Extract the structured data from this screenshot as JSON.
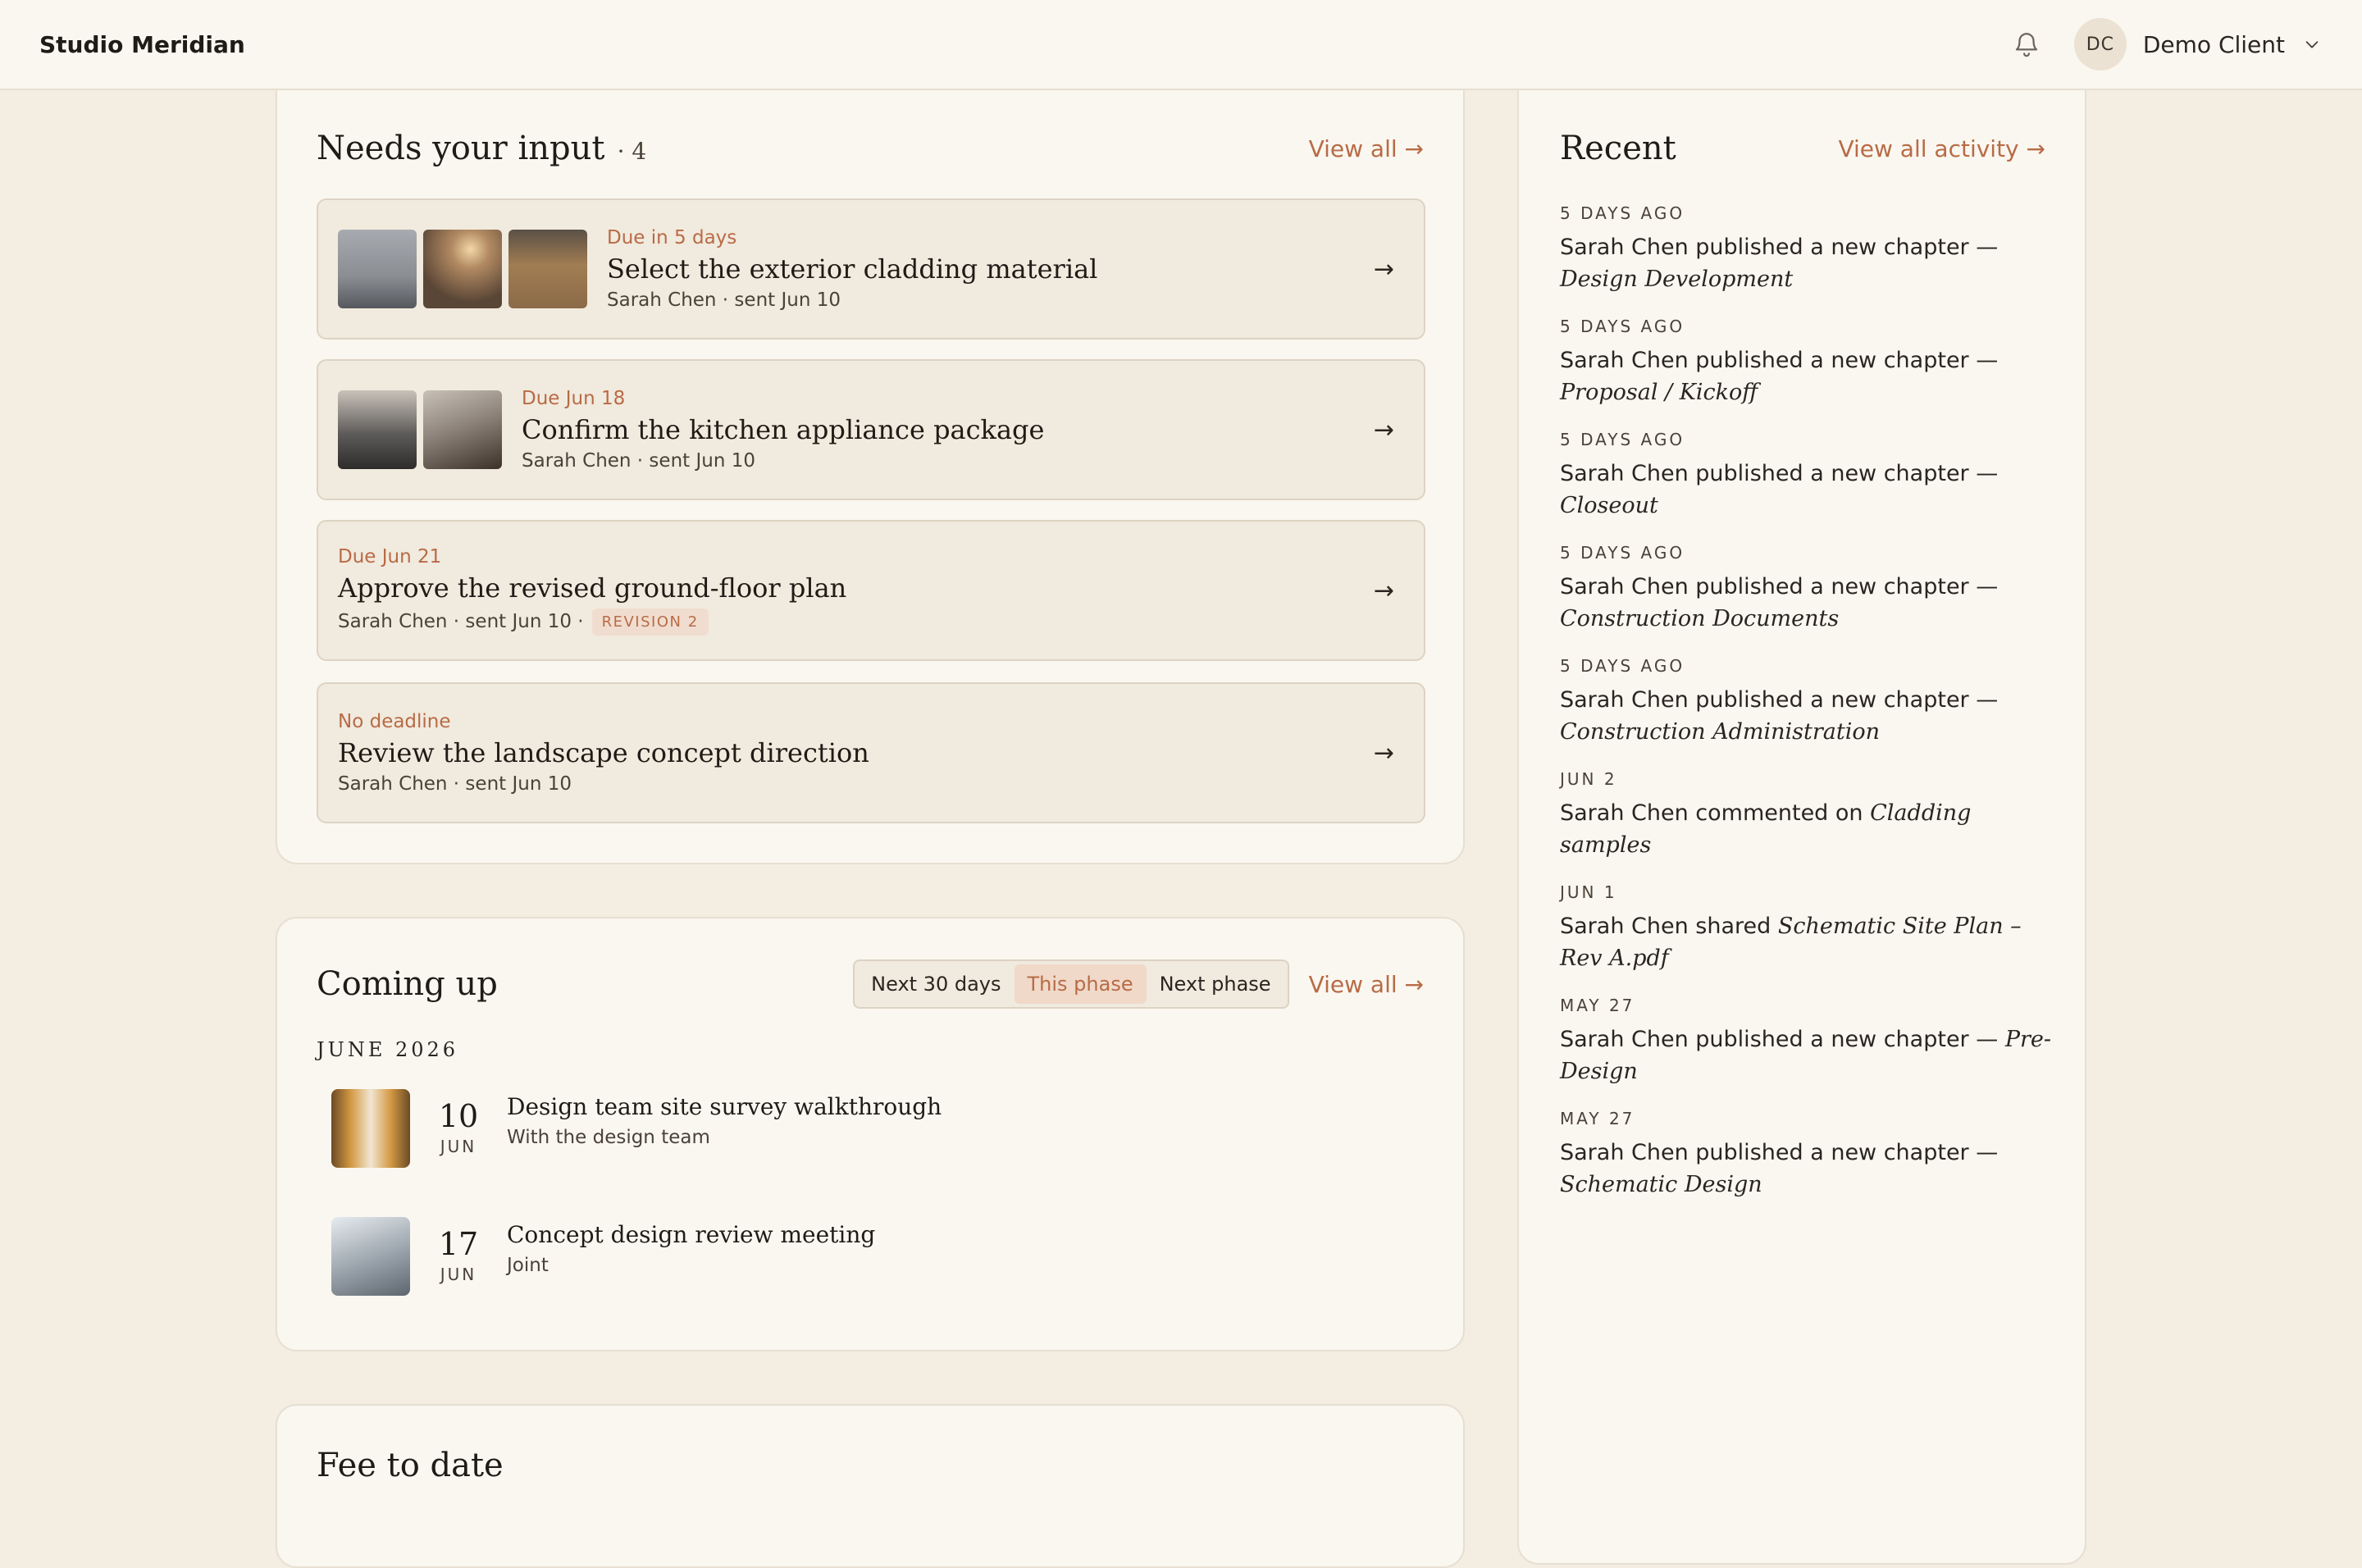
{
  "header": {
    "brand": "Studio Meridian",
    "user_initials": "DC",
    "user_name": "Demo Client"
  },
  "needs_input": {
    "title": "Needs your input",
    "count": "· 4",
    "view_all": "View all →",
    "items": [
      {
        "due": "Due in 5 days",
        "title": "Select the exterior cladding material",
        "meta": "Sarah Chen · sent Jun 10",
        "thumbs": [
          "#8a8d92",
          "#6f5a46",
          "#8b6a48"
        ]
      },
      {
        "due": "Due Jun 18",
        "title": "Confirm the kitchen appliance package",
        "meta": "Sarah Chen · sent Jun 10",
        "thumbs": [
          "#5e5c5a",
          "#8f857c"
        ]
      },
      {
        "due": "Due Jun 21",
        "title": "Approve the revised ground-floor plan",
        "meta": "Sarah Chen · sent Jun 10 ·",
        "badge": "REVISION 2"
      },
      {
        "due": "No deadline",
        "title": "Review the landscape concept direction",
        "meta": "Sarah Chen · sent Jun 10"
      }
    ],
    "arrow": "→"
  },
  "coming_up": {
    "title": "Coming up",
    "segments": [
      "Next 30 days",
      "This phase",
      "Next phase"
    ],
    "active_segment": "This phase",
    "view_all": "View all →",
    "month": "JUNE 2026",
    "events": [
      {
        "day": "10",
        "mon": "JUN",
        "title": "Design team site survey walkthrough",
        "sub": "With the design team",
        "thumb": "#9a6a3a"
      },
      {
        "day": "17",
        "mon": "JUN",
        "title": "Concept design review meeting",
        "sub": "Joint",
        "thumb": "#9aa3ab"
      }
    ]
  },
  "fee": {
    "title": "Fee to date"
  },
  "recent": {
    "title": "Recent",
    "view_all": "View all activity →",
    "items": [
      {
        "time": "5 DAYS AGO",
        "text": "Sarah Chen published a new chapter —",
        "em": "Design Development"
      },
      {
        "time": "5 DAYS AGO",
        "text": "Sarah Chen published a new chapter —",
        "em": "Proposal / Kickoff"
      },
      {
        "time": "5 DAYS AGO",
        "text": "Sarah Chen published a new chapter —",
        "em": "Closeout"
      },
      {
        "time": "5 DAYS AGO",
        "text": "Sarah Chen published a new chapter —",
        "em": "Construction Documents"
      },
      {
        "time": "5 DAYS AGO",
        "text": "Sarah Chen published a new chapter —",
        "em": "Construction Administration"
      },
      {
        "time": "JUN 2",
        "text": "Sarah Chen commented on",
        "em": "Cladding samples"
      },
      {
        "time": "JUN 1",
        "text": "Sarah Chen shared",
        "em": "Schematic Site Plan – Rev A.pdf"
      },
      {
        "time": "MAY 27",
        "text": "Sarah Chen published a new chapter —",
        "em": "Pre-Design"
      },
      {
        "time": "MAY 27",
        "text": "Sarah Chen published a new chapter —",
        "em": "Schematic Design"
      }
    ]
  }
}
